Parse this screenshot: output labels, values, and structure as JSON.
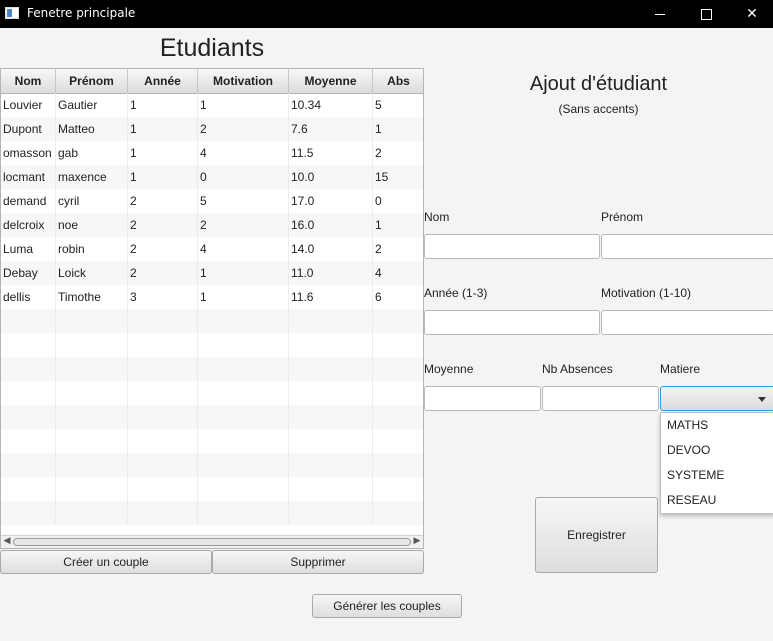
{
  "window": {
    "title": "Fenetre principale",
    "minimize_glyph": "–",
    "maximize_glyph": "□",
    "close_glyph": "✕"
  },
  "left": {
    "heading": "Etudiants",
    "columns": [
      "Nom",
      "Prénom",
      "Année",
      "Motivation",
      "Moyenne",
      "Abs"
    ],
    "rows": [
      [
        "Louvier",
        "Gautier",
        "1",
        "1",
        "10.34",
        "5"
      ],
      [
        "Dupont",
        "Matteo",
        "1",
        "2",
        "7.6",
        "1"
      ],
      [
        "omasson",
        "gab",
        "1",
        "4",
        "11.5",
        "2"
      ],
      [
        "locmant",
        "maxence",
        "1",
        "0",
        "10.0",
        "15"
      ],
      [
        "demand",
        "cyril",
        "2",
        "5",
        "17.0",
        "0"
      ],
      [
        "delcroix",
        "noe",
        "2",
        "2",
        "16.0",
        "1"
      ],
      [
        "Luma",
        "robin",
        "2",
        "4",
        "14.0",
        "2"
      ],
      [
        "Debay",
        "Loick",
        "2",
        "1",
        "11.0",
        "4"
      ],
      [
        "dellis",
        "Timothe",
        "3",
        "1",
        "11.6",
        "6"
      ]
    ],
    "create_couple_label": "Créer un couple",
    "delete_label": "Supprimer"
  },
  "generate_label": "Générer les couples",
  "form": {
    "heading": "Ajout d'étudiant",
    "subheading": "(Sans accents)",
    "nom_label": "Nom",
    "prenom_label": "Prénom",
    "annee_label": "Année (1-3)",
    "motivation_label": "Motivation (1-10)",
    "moyenne_label": "Moyenne",
    "absences_label": "Nb Absences",
    "matiere_label": "Matiere",
    "matiere_options": [
      "MATHS",
      "DEVOO",
      "SYSTEME",
      "RESEAU"
    ],
    "save_label": "Enregistrer"
  },
  "colors": {
    "titlebar": "#000000",
    "focus_border": "#3b99d6"
  }
}
